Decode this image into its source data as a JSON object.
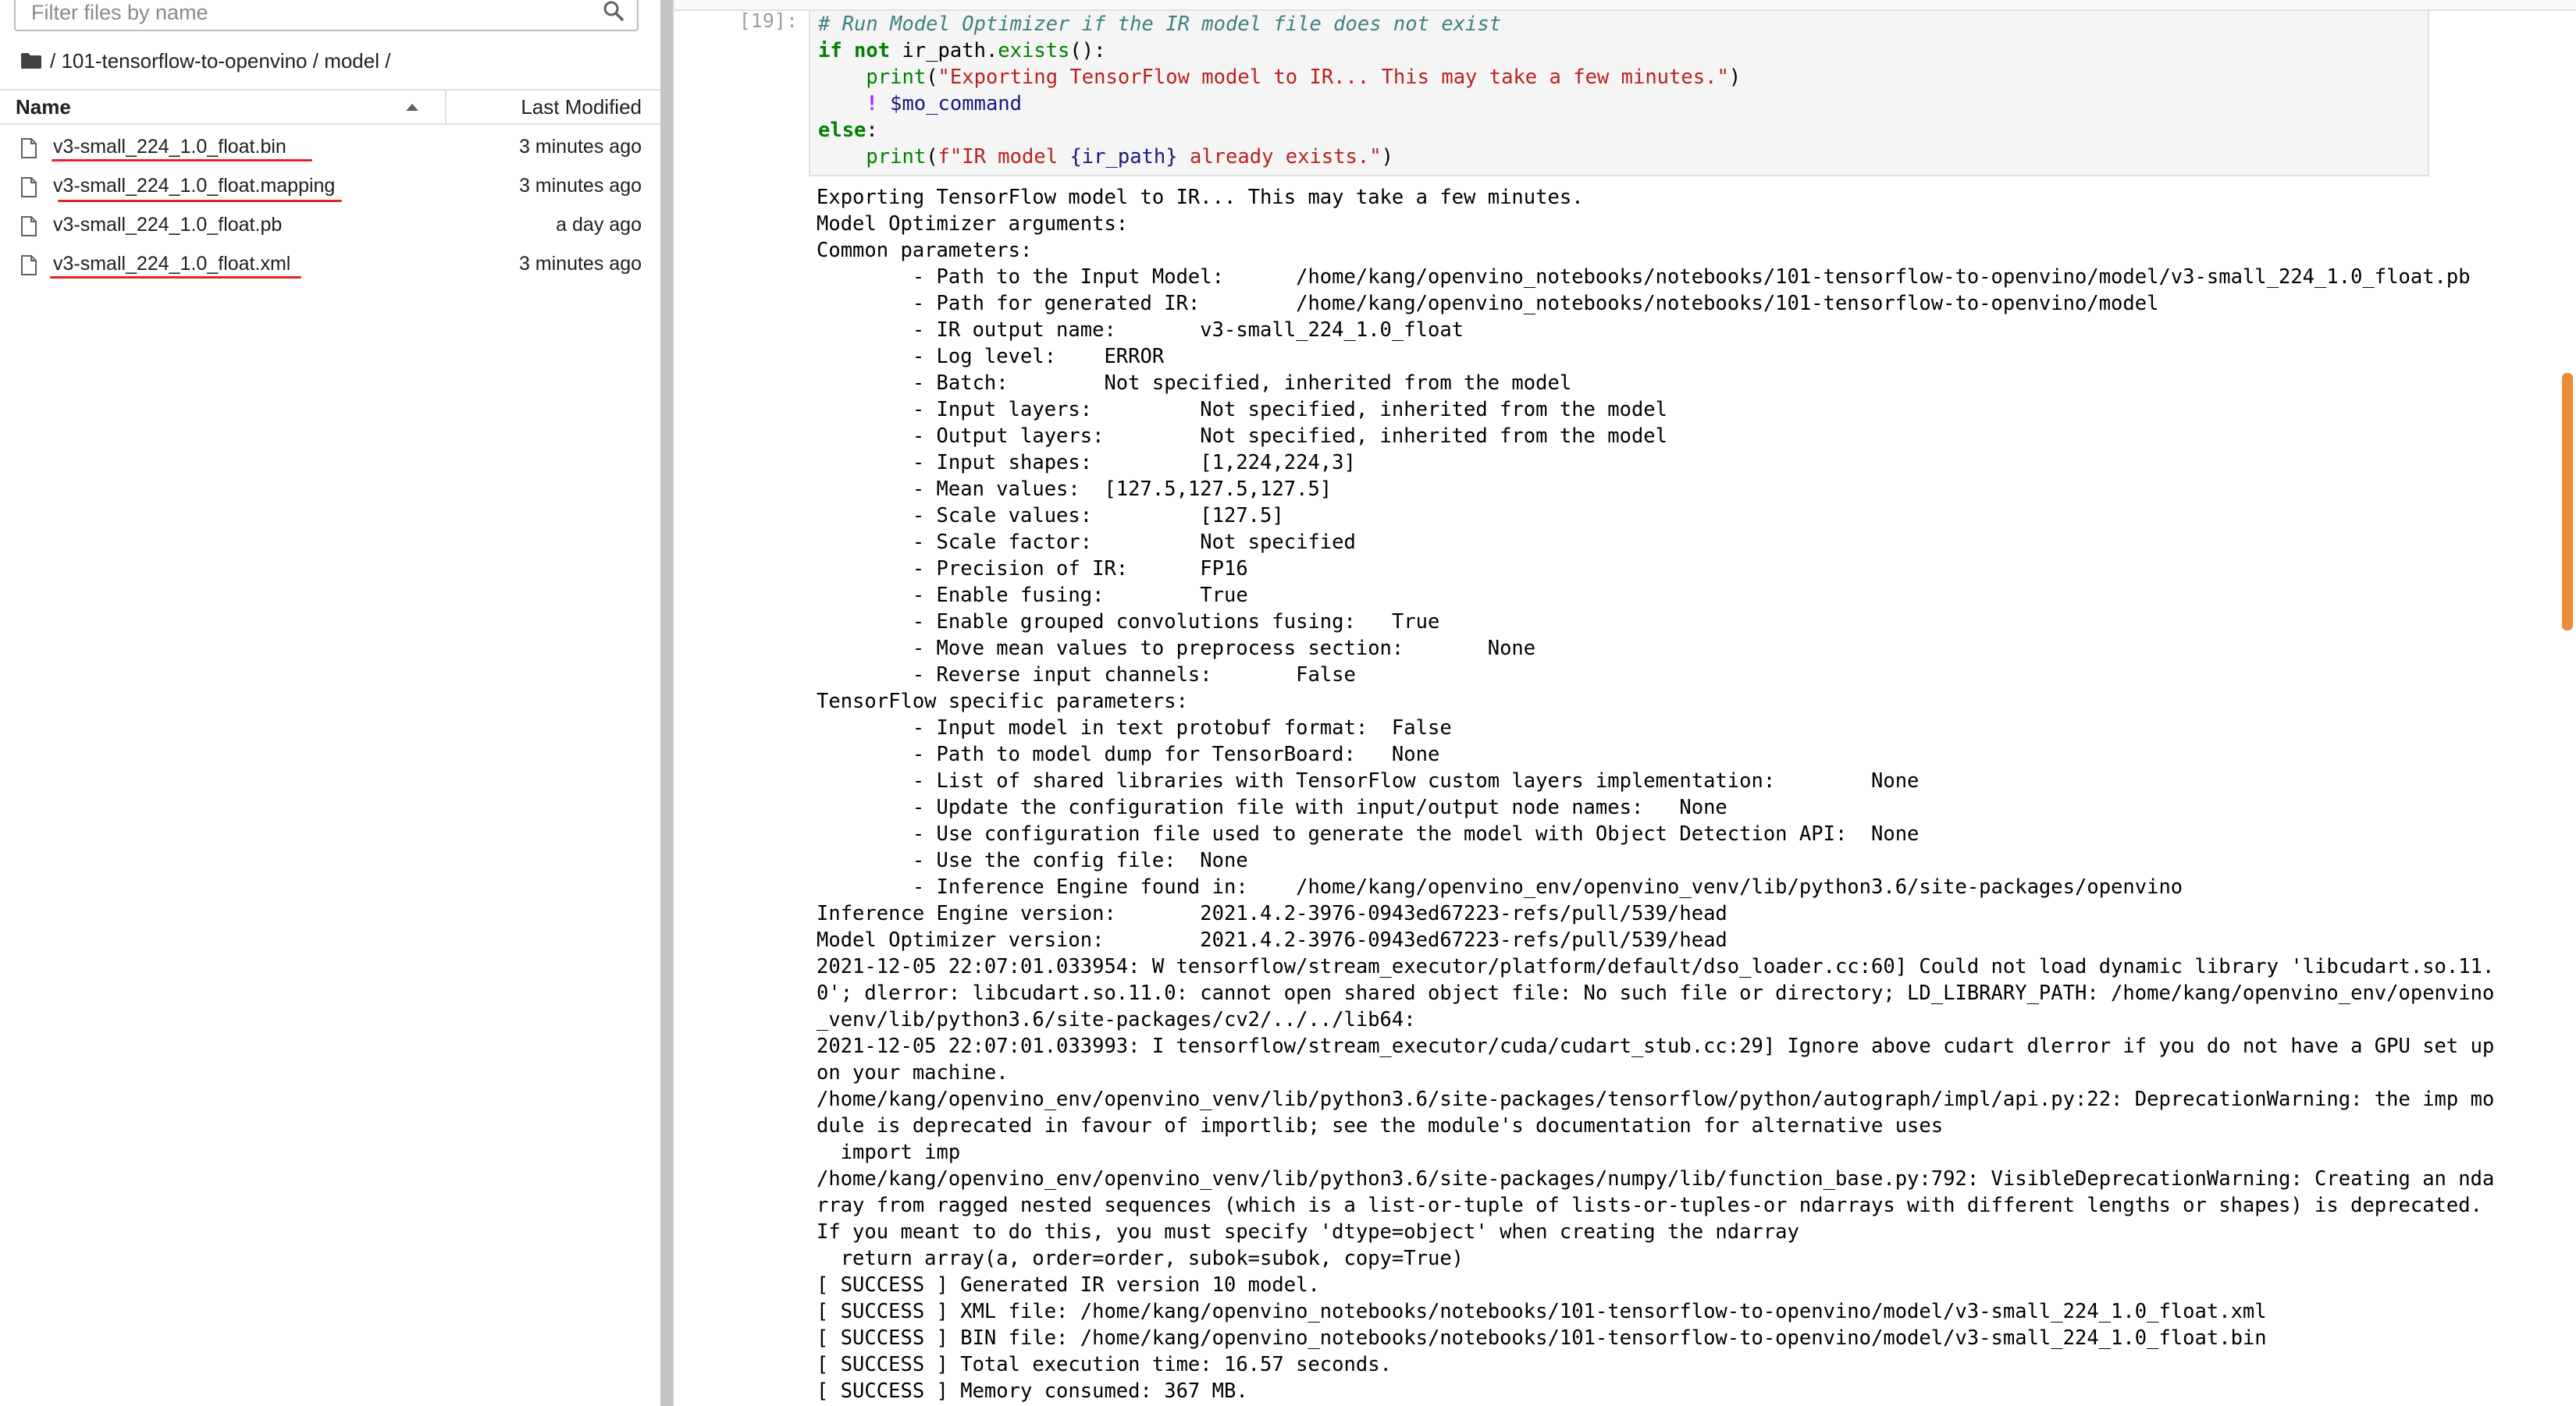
{
  "filebrowser": {
    "filter_placeholder": "Filter files by name",
    "path": "/ 101-tensorflow-to-openvino / model /",
    "columns": {
      "name": "Name",
      "modified": "Last Modified"
    },
    "files": [
      {
        "name": "v3-small_224_1.0_float.bin",
        "modified": "3 minutes ago",
        "marked": true
      },
      {
        "name": "v3-small_224_1.0_float.mapping",
        "modified": "3 minutes ago",
        "marked": true
      },
      {
        "name": "v3-small_224_1.0_float.pb",
        "modified": "a day ago",
        "marked": false
      },
      {
        "name": "v3-small_224_1.0_float.xml",
        "modified": "3 minutes ago",
        "marked": true
      }
    ],
    "annotation_color": "#e8202a"
  },
  "notebook": {
    "cell_prompt": "[19]:",
    "code": {
      "line1_comment": "# Run Model Optimizer if the IR model file does not exist",
      "line2_kw": "if not",
      "line2_rest": " ir_path.",
      "line2_fn": "exists",
      "line2_end": "():",
      "line3_indent": "    ",
      "line3_fn": "print",
      "line3_open": "(",
      "line3_str": "\"Exporting TensorFlow model to IR... This may take a few minutes.\"",
      "line3_close": ")",
      "line4_indent": "    ",
      "line4_bang": "!",
      "line4_space": " ",
      "line4_magic": "$mo_command",
      "line5_kw": "else",
      "line5_colon": ":",
      "line6_indent": "    ",
      "line6_fn": "print",
      "line6_open": "(",
      "line6_str_a": "f\"IR model ",
      "line6_var": "{ir_path}",
      "line6_str_b": " already exists.\"",
      "line6_close": ")"
    },
    "output_lines": [
      "Exporting TensorFlow model to IR... This may take a few minutes.",
      "Model Optimizer arguments:",
      "Common parameters:",
      "        - Path to the Input Model:      /home/kang/openvino_notebooks/notebooks/101-tensorflow-to-openvino/model/v3-small_224_1.0_float.pb",
      "        - Path for generated IR:        /home/kang/openvino_notebooks/notebooks/101-tensorflow-to-openvino/model",
      "        - IR output name:       v3-small_224_1.0_float",
      "        - Log level:    ERROR",
      "        - Batch:        Not specified, inherited from the model",
      "        - Input layers:         Not specified, inherited from the model",
      "        - Output layers:        Not specified, inherited from the model",
      "        - Input shapes:         [1,224,224,3]",
      "        - Mean values:  [127.5,127.5,127.5]",
      "        - Scale values:         [127.5]",
      "        - Scale factor:         Not specified",
      "        - Precision of IR:      FP16",
      "        - Enable fusing:        True",
      "        - Enable grouped convolutions fusing:   True",
      "        - Move mean values to preprocess section:       None",
      "        - Reverse input channels:       False",
      "TensorFlow specific parameters:",
      "        - Input model in text protobuf format:  False",
      "        - Path to model dump for TensorBoard:   None",
      "        - List of shared libraries with TensorFlow custom layers implementation:        None",
      "        - Update the configuration file with input/output node names:   None",
      "        - Use configuration file used to generate the model with Object Detection API:  None",
      "        - Use the config file:  None",
      "        - Inference Engine found in:    /home/kang/openvino_env/openvino_venv/lib/python3.6/site-packages/openvino",
      "Inference Engine version:       2021.4.2-3976-0943ed67223-refs/pull/539/head",
      "Model Optimizer version:        2021.4.2-3976-0943ed67223-refs/pull/539/head",
      "2021-12-05 22:07:01.033954: W tensorflow/stream_executor/platform/default/dso_loader.cc:60] Could not load dynamic library 'libcudart.so.11.",
      "0'; dlerror: libcudart.so.11.0: cannot open shared object file: No such file or directory; LD_LIBRARY_PATH: /home/kang/openvino_env/openvino",
      "_venv/lib/python3.6/site-packages/cv2/../../lib64:",
      "2021-12-05 22:07:01.033993: I tensorflow/stream_executor/cuda/cudart_stub.cc:29] Ignore above cudart dlerror if you do not have a GPU set up",
      "on your machine.",
      "/home/kang/openvino_env/openvino_venv/lib/python3.6/site-packages/tensorflow/python/autograph/impl/api.py:22: DeprecationWarning: the imp mo",
      "dule is deprecated in favour of importlib; see the module's documentation for alternative uses",
      "  import imp",
      "/home/kang/openvino_env/openvino_venv/lib/python3.6/site-packages/numpy/lib/function_base.py:792: VisibleDeprecationWarning: Creating an nda",
      "rray from ragged nested sequences (which is a list-or-tuple of lists-or-tuples-or ndarrays with different lengths or shapes) is deprecated.",
      "If you meant to do this, you must specify 'dtype=object' when creating the ndarray",
      "  return array(a, order=order, subok=subok, copy=True)",
      "[ SUCCESS ] Generated IR version 10 model.",
      "[ SUCCESS ] XML file: /home/kang/openvino_notebooks/notebooks/101-tensorflow-to-openvino/model/v3-small_224_1.0_float.xml",
      "[ SUCCESS ] BIN file: /home/kang/openvino_notebooks/notebooks/101-tensorflow-to-openvino/model/v3-small_224_1.0_float.bin",
      "[ SUCCESS ] Total execution time: 16.57 seconds.",
      "[ SUCCESS ] Memory consumed: 367 MB."
    ],
    "scrollbar_color": "#ea8c3a"
  }
}
